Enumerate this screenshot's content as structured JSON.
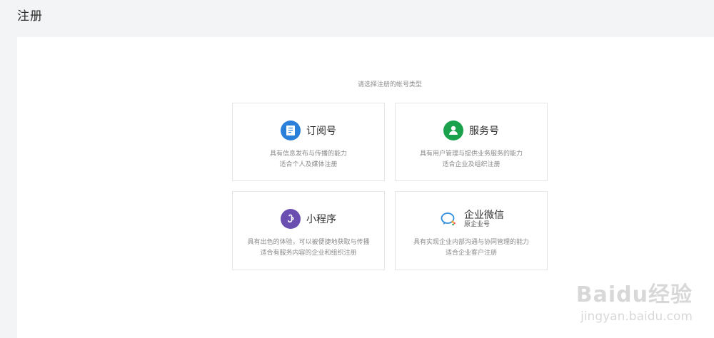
{
  "header": {
    "title": "注册"
  },
  "prompt": "请选择注册的帐号类型",
  "cards": [
    {
      "name": "订阅号",
      "desc_line1": "具有信息发布与传播的能力",
      "desc_line2": "适合个人及媒体注册",
      "icon": "document-icon",
      "color": "#2a80d8"
    },
    {
      "name": "服务号",
      "desc_line1": "具有用户管理与提供业务服务的能力",
      "desc_line2": "适合企业及组织注册",
      "icon": "user-icon",
      "color": "#1aa14b"
    },
    {
      "name": "小程序",
      "desc_line1": "具有出色的体验，可以被便捷地获取与传播",
      "desc_line2": "适合有服务内容的企业和组织注册",
      "icon": "mini-program-icon",
      "color": "#6b4fb0"
    },
    {
      "name": "企业微信",
      "name_sub": "原企业号",
      "desc_line1": "具有实现企业内部沟通与协同管理的能力",
      "desc_line2": "适合企业客户注册",
      "icon": "work-wechat-icon",
      "color": "#2a8ce0"
    }
  ],
  "watermark": {
    "brand": "Baidu经验",
    "url": "jingyan.baidu.com"
  }
}
